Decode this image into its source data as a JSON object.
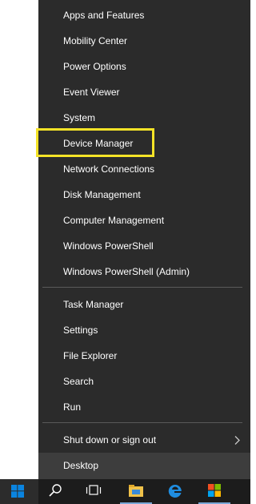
{
  "menu": {
    "items": [
      {
        "label": "Apps and Features"
      },
      {
        "label": "Mobility Center"
      },
      {
        "label": "Power Options"
      },
      {
        "label": "Event Viewer"
      },
      {
        "label": "System"
      },
      {
        "label": "Device Manager"
      },
      {
        "label": "Network Connections"
      },
      {
        "label": "Disk Management"
      },
      {
        "label": "Computer Management"
      },
      {
        "label": "Windows PowerShell"
      },
      {
        "label": "Windows PowerShell (Admin)"
      },
      {
        "label": "Task Manager"
      },
      {
        "label": "Settings"
      },
      {
        "label": "File Explorer"
      },
      {
        "label": "Search"
      },
      {
        "label": "Run"
      },
      {
        "label": "Shut down or sign out"
      },
      {
        "label": "Desktop"
      }
    ]
  },
  "taskbar": {
    "icons": [
      "windows-logo-icon",
      "search-icon",
      "task-view-icon",
      "file-explorer-icon",
      "edge-icon",
      "store-icon"
    ]
  },
  "colors": {
    "menu_bg": "#2b2b2b",
    "highlight": "#f5e327",
    "taskbar_bg": "#1c1c1c",
    "windows_blue": "#0078d7"
  }
}
